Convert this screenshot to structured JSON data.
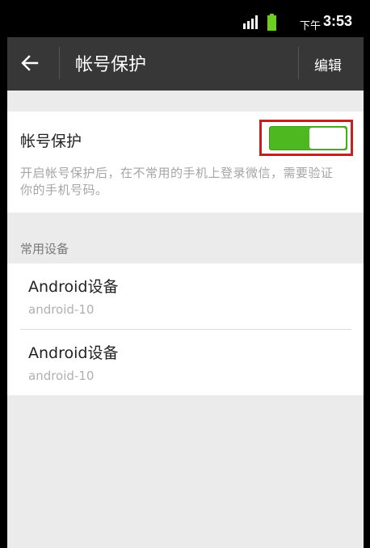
{
  "status_bar": {
    "ampm": "下午",
    "time": "3:53"
  },
  "action_bar": {
    "title": "帐号保护",
    "edit_label": "编辑"
  },
  "protection": {
    "title": "帐号保护",
    "description": "开启帐号保护后，在不常用的手机上登录微信，需要验证你的手机号码。",
    "enabled": true
  },
  "devices": {
    "header": "常用设备",
    "items": [
      {
        "name": "Android设备",
        "id": "android-10"
      },
      {
        "name": "Android设备",
        "id": "android-10"
      }
    ]
  },
  "colors": {
    "toggle_on": "#4eb820",
    "highlight_box": "#c81e1e",
    "action_bar": "#373737"
  }
}
